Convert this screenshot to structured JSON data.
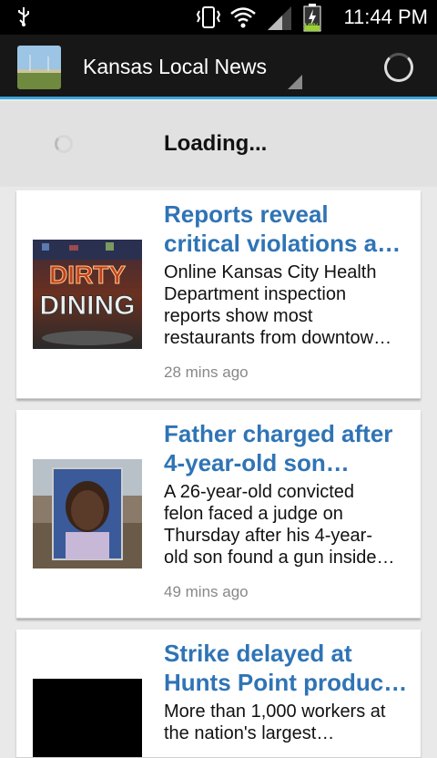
{
  "status_bar": {
    "time": "11:44 PM",
    "battery_percent": "18%",
    "icons": [
      "usb-icon",
      "vibrate-icon",
      "wifi-icon",
      "signal-icon",
      "battery-charging-icon"
    ]
  },
  "action_bar": {
    "title": "Kansas Local News"
  },
  "loading": {
    "text": "Loading..."
  },
  "articles": [
    {
      "title_lines": [
        "Reports reveal",
        "critical violations at…"
      ],
      "desc_lines": [
        "Online Kansas City Health",
        "Department inspection",
        "reports show most",
        "restaurants from downtow…"
      ],
      "time": "28 mins ago",
      "thumb_text": "DIRTY DINING"
    },
    {
      "title_lines": [
        "Father charged after",
        "4-year-old son…"
      ],
      "desc_lines": [
        "A 26-year-old convicted",
        "felon faced a judge on",
        "Thursday after his 4-year-",
        "old son found a gun inside…"
      ],
      "time": "49 mins ago"
    },
    {
      "title_lines": [
        "Strike delayed at",
        "Hunts Point produc…"
      ],
      "desc_lines": [
        "More than 1,000 workers at",
        "the nation's largest…"
      ],
      "time": ""
    }
  ],
  "colors": {
    "accent": "#39a5dc",
    "title_blue": "#2f74b5",
    "action_bar": "#171717"
  }
}
